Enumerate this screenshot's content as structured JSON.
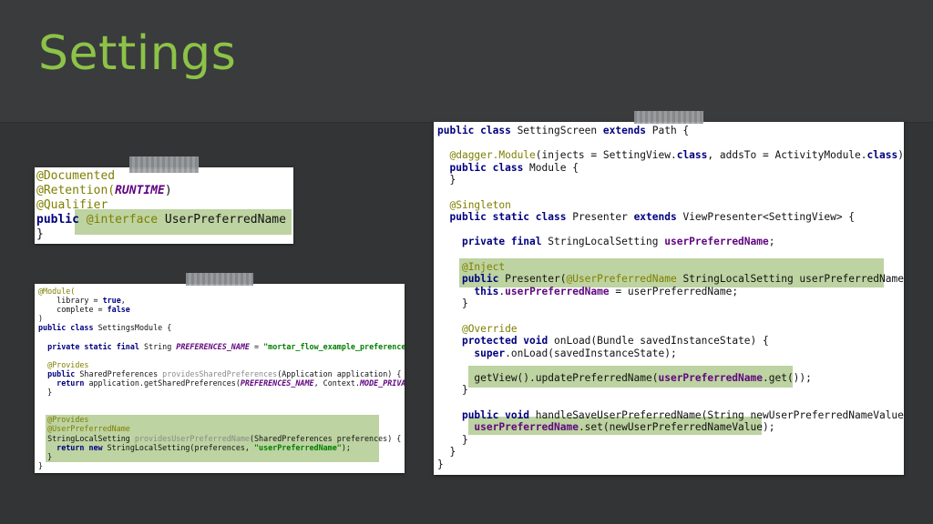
{
  "slide": {
    "title": "Settings"
  },
  "panels": {
    "qualifier": {
      "lines": [
        "@Documented",
        "@Retention(RUNTIME)",
        "@Qualifier",
        "public @interface UserPreferredName {",
        "}"
      ]
    },
    "module": {
      "lines": [
        "@Module(",
        "    library = true,",
        "    complete = false",
        ")",
        "public class SettingsModule {",
        "",
        "  private static final String PREFERENCES_NAME = \"mortar_flow_example_preferences\";",
        "",
        "  @Provides",
        "  public SharedPreferences providesSharedPreferences(Application application) {",
        "    return application.getSharedPreferences(PREFERENCES_NAME, Context.MODE_PRIVATE);",
        "  }",
        "",
        "",
        "  @Provides",
        "  @UserPreferredName",
        "  StringLocalSetting providesUserPreferredName(SharedPreferences preferences) {",
        "    return new StringLocalSetting(preferences, \"userPreferredName\");",
        "  }",
        "}"
      ]
    },
    "screen": {
      "lines": [
        "public class SettingScreen extends Path {",
        "",
        "  @dagger.Module(injects = SettingView.class, addsTo = ActivityModule.class)",
        "  public class Module {",
        "  }",
        "",
        "  @Singleton",
        "  public static class Presenter extends ViewPresenter<SettingView> {",
        "",
        "    private final StringLocalSetting userPreferredName;",
        "",
        "    @Inject",
        "    public Presenter(@UserPreferredName StringLocalSetting userPreferredName) {",
        "      this.userPreferredName = userPreferredName;",
        "    }",
        "",
        "    @Override",
        "    protected void onLoad(Bundle savedInstanceState) {",
        "      super.onLoad(savedInstanceState);",
        "",
        "      getView().updatePreferredName(userPreferredName.get());",
        "    }",
        "",
        "    public void handleSaveUserPreferredName(String newUserPreferredNameValue) {",
        "      userPreferredName.set(newUserPreferredNameValue);",
        "    }",
        "  }",
        "}"
      ]
    }
  }
}
